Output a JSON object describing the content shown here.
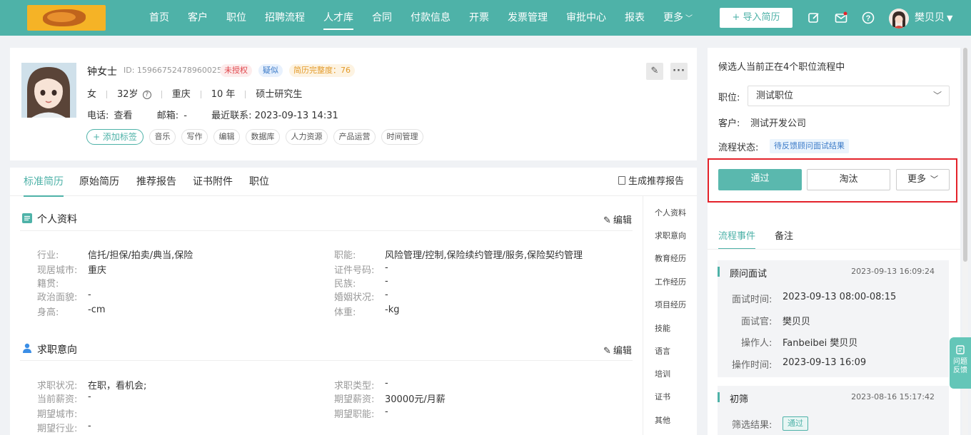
{
  "nav": {
    "items": [
      "首页",
      "客户",
      "职位",
      "招聘流程",
      "人才库",
      "合同",
      "付款信息",
      "开票",
      "发票管理",
      "审批中心",
      "报表",
      "更多"
    ],
    "active": "人才库",
    "import_btn": "+ 导入简历",
    "user_name": "樊贝贝"
  },
  "profile": {
    "name": "钟女士",
    "id": "ID: 159667524789600256",
    "tags": {
      "unauth": "未授权",
      "suspect": "疑似",
      "complete": "简历完整度：76"
    },
    "gender": "女",
    "age": "32岁",
    "city": "重庆",
    "years": "10 年",
    "degree": "硕士研究生",
    "phone_label": "电话:",
    "phone_value": "查看",
    "email_label": "邮箱:",
    "email_value": "-",
    "last_contact_label": "最近联系:",
    "last_contact_value": "2023-09-13 14:31",
    "add_tag": "+ 添加标签",
    "skill_tags": [
      "音乐",
      "写作",
      "编辑",
      "数据库",
      "人力资源",
      "产品运营",
      "时间管理"
    ]
  },
  "resume": {
    "tabs": [
      "标准简历",
      "原始简历",
      "推荐报告",
      "证书附件",
      "职位"
    ],
    "gen_report": "生成推荐报告",
    "edit": "编辑",
    "personal": {
      "title": "个人资料",
      "left": [
        {
          "label": "行业:",
          "value": "信托/担保/拍卖/典当,保险"
        },
        {
          "label": "现居城市:",
          "value": "重庆"
        },
        {
          "label": "籍贯:",
          "value": ""
        },
        {
          "label": "政治面貌:",
          "value": "-"
        },
        {
          "label": "身高:",
          "value": "-cm"
        }
      ],
      "right": [
        {
          "label": "职能:",
          "value": "风险管理/控制,保险续约管理/服务,保险契约管理"
        },
        {
          "label": "证件号码:",
          "value": "-"
        },
        {
          "label": "民族:",
          "value": "-"
        },
        {
          "label": "婚姻状况:",
          "value": "-"
        },
        {
          "label": "体重:",
          "value": "-kg"
        }
      ]
    },
    "intention": {
      "title": "求职意向",
      "left": [
        {
          "label": "求职状况:",
          "value": "在职，看机会;"
        },
        {
          "label": "当前薪资:",
          "value": "-"
        },
        {
          "label": "期望城市:",
          "value": ""
        },
        {
          "label": "期望行业:",
          "value": "-"
        }
      ],
      "right": [
        {
          "label": "求职类型:",
          "value": "-"
        },
        {
          "label": "期望薪资:",
          "value": "30000元/月薪"
        },
        {
          "label": "期望职能:",
          "value": "-"
        }
      ]
    },
    "side_nav": [
      "个人资料",
      "求职意向",
      "教育经历",
      "工作经历",
      "项目经历",
      "技能",
      "语言",
      "培训",
      "证书",
      "其他"
    ]
  },
  "pipeline": {
    "header": "候选人当前正在4个职位流程中",
    "position_label": "职位:",
    "position_value": "测试职位",
    "client_label": "客户:",
    "client_value": "测试开发公司",
    "status_label": "流程状态:",
    "status_value": "待反馈顾问面试结果",
    "pass_btn": "通过",
    "reject_btn": "淘汰",
    "more_btn": "更多",
    "tabs": [
      "流程事件",
      "备注"
    ],
    "events": [
      {
        "title": "顾问面试",
        "time": "2023-09-13 16:09:24",
        "rows": [
          {
            "label": "面试时间:",
            "value": "2023-09-13 08:00-08:15"
          },
          {
            "label": "面试官:",
            "value": "樊贝贝"
          },
          {
            "label": "操作人:",
            "value": "Fanbeibei 樊贝贝"
          },
          {
            "label": "操作时间:",
            "value": "2023-09-13 16:09"
          }
        ]
      },
      {
        "title": "初筛",
        "time": "2023-08-16 15:17:42",
        "result_label": "筛选结果:",
        "result_value": "通过"
      }
    ]
  },
  "feedback": "问题反馈",
  "colors": {
    "brand": "#4eb2a8",
    "danger": "#e4222a"
  }
}
